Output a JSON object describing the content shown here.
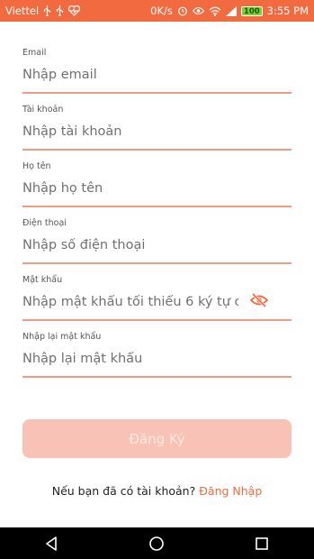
{
  "status_bar": {
    "carrier": "Viettel",
    "speed": "0K/s",
    "battery": "100",
    "time": "3:55 PM"
  },
  "form": {
    "email": {
      "label": "Email",
      "placeholder": "Nhập email"
    },
    "username": {
      "label": "Tài khoản",
      "placeholder": "Nhập tài khoản"
    },
    "fullname": {
      "label": "Họ tên",
      "placeholder": "Nhập họ tên"
    },
    "phone": {
      "label": "Điện thoại",
      "placeholder": "Nhập số điện thoại"
    },
    "password": {
      "label": "Mật khẩu",
      "placeholder": "Nhập mật khẩu tối thiểu 6 ký tự c"
    },
    "confirm_password": {
      "label": "Nhập lại mật khẩu",
      "placeholder": "Nhập lại mật khẩu"
    }
  },
  "register_button": {
    "label": "Đăng Ký"
  },
  "login_prompt": {
    "text": "Nếu bạn đã có tài khoản?",
    "link": "Đăng Nhập"
  },
  "colors": {
    "accent": "#f26a3f",
    "button_disabled": "#f8c3b6",
    "underline": "#f19a84"
  },
  "icons": [
    "usb-icon",
    "heart-monitor-icon",
    "alarm-icon",
    "eye-icon",
    "wifi-icon",
    "signal-icon",
    "battery-icon",
    "eye-off-icon",
    "back-icon",
    "home-icon",
    "recents-icon"
  ]
}
